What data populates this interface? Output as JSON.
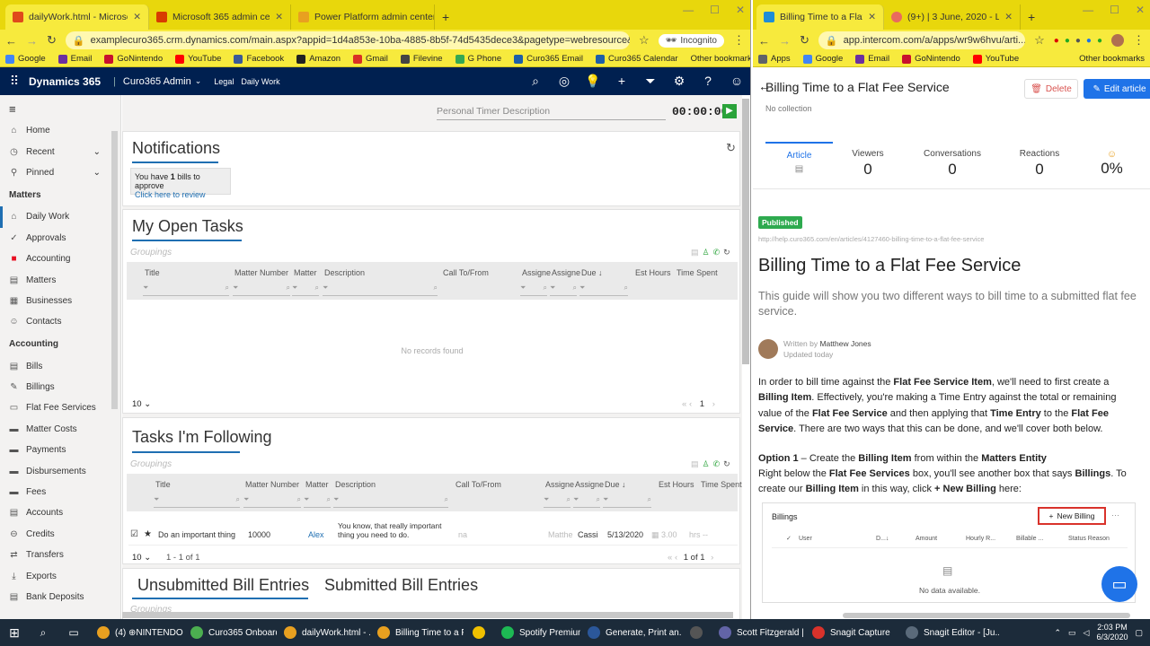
{
  "left_browser": {
    "tabs": [
      {
        "label": "dailyWork.html - Microsoft Dyna",
        "color": "#e04a1b"
      },
      {
        "label": "Microsoft 365 admin center - All",
        "color": "#d83b01"
      },
      {
        "label": "Power Platform admin center",
        "color": "#e8a020"
      }
    ],
    "new_tab": "+",
    "url": "examplecuro365.crm.dynamics.com/main.aspx?appid=1d4a853e-10ba-4885-8b5f-74d5435dece3&pagetype=webresource&webresourceName=cur...",
    "incognito": "Incognito",
    "bookmarks": [
      {
        "label": "Google",
        "color": "#4285f4"
      },
      {
        "label": "Email",
        "color": "#6b2fa0"
      },
      {
        "label": "GoNintendo",
        "color": "#c8102e"
      },
      {
        "label": "YouTube",
        "color": "#ff0000"
      },
      {
        "label": "Facebook",
        "color": "#3b5998"
      },
      {
        "label": "Amazon",
        "color": "#222222"
      },
      {
        "label": "Gmail",
        "color": "#d93025"
      },
      {
        "label": "Filevine",
        "color": "#444444"
      },
      {
        "label": "G Phone",
        "color": "#34a853"
      },
      {
        "label": "Curo365 Email",
        "color": "#1e5fa8"
      },
      {
        "label": "Curo365 Calendar",
        "color": "#1e5fa8"
      }
    ],
    "other_bookmarks": "Other bookmarks"
  },
  "d365": {
    "app": "Dynamics 365",
    "area": "Curo365 Admin",
    "crumb1": "Legal",
    "crumb2": "Daily Work",
    "timer_placeholder": "Personal Timer Description",
    "timer": "00:00:00"
  },
  "sidebar": {
    "top": [
      {
        "label": "Home",
        "icon": "⌂"
      },
      {
        "label": "Recent",
        "icon": "◷"
      },
      {
        "label": "Pinned",
        "icon": "⚲"
      }
    ],
    "matters_head": "Matters",
    "matters": [
      {
        "label": "Daily Work",
        "icon": "⌂"
      },
      {
        "label": "Approvals",
        "icon": "✓"
      },
      {
        "label": "Accounting",
        "icon": "■"
      },
      {
        "label": "Matters",
        "icon": "▤"
      },
      {
        "label": "Businesses",
        "icon": "▦"
      },
      {
        "label": "Contacts",
        "icon": "☺"
      }
    ],
    "accounting_head": "Accounting",
    "accounting": [
      {
        "label": "Bills",
        "icon": "▤"
      },
      {
        "label": "Billings",
        "icon": "✎"
      },
      {
        "label": "Flat Fee Services",
        "icon": "▭"
      },
      {
        "label": "Matter Costs",
        "icon": "▬"
      },
      {
        "label": "Payments",
        "icon": "▬"
      },
      {
        "label": "Disbursements",
        "icon": "▬"
      },
      {
        "label": "Fees",
        "icon": "▬"
      },
      {
        "label": "Accounts",
        "icon": "▤"
      },
      {
        "label": "Credits",
        "icon": "⊖"
      },
      {
        "label": "Transfers",
        "icon": "⇄"
      },
      {
        "label": "Exports",
        "icon": "⤓"
      },
      {
        "label": "Bank Deposits",
        "icon": "▤"
      }
    ]
  },
  "notifications": {
    "title": "Notifications",
    "line1_a": "You have ",
    "line1_b": "1",
    "line1_c": " bills to approve",
    "link": "Click here to review"
  },
  "open_tasks": {
    "title": "My Open Tasks",
    "groupings": "Groupings",
    "columns": [
      "Title",
      "Matter Number",
      "Matter",
      "Description",
      "Call To/From",
      "Assigne",
      "Assigne",
      "Due ↓",
      "Est Hours",
      "Time Spent"
    ],
    "empty": "No records found",
    "page_size": "10",
    "page": "1"
  },
  "following": {
    "title": "Tasks I'm Following",
    "groupings": "Groupings",
    "columns": [
      "Title",
      "Matter Number",
      "Matter",
      "Description",
      "Call To/From",
      "Assigne",
      "Assigne",
      "Due ↓",
      "Est Hours",
      "Time Spent"
    ],
    "row": {
      "title": "Do an important thing",
      "number": "10000",
      "matter": "Alex",
      "desc": "You know, that really important thing you need to do.",
      "call": "na",
      "a1": "Matthe",
      "a2": "Cassi",
      "due": "5/13/2020",
      "est": "3.00",
      "hrs": "hrs --"
    },
    "page_size": "10",
    "range": "1 - 1 of 1",
    "page": "1 of 1"
  },
  "bill_tabs": {
    "unsubmitted": "Unsubmitted Bill Entries",
    "submitted": "Submitted Bill Entries",
    "groupings": "Groupings"
  },
  "right_browser": {
    "tabs": [
      {
        "label": "Billing Time to a Flat Fee Ser",
        "color": "#1f8dd6"
      },
      {
        "label": "(9+) | 3 June, 2020 - Loom P",
        "color": "#e96a5e"
      }
    ],
    "url": "app.intercom.com/a/apps/wr9w6hvu/arti...",
    "bookmarks": [
      {
        "label": "Apps",
        "color": "#5f6368"
      },
      {
        "label": "Google",
        "color": "#4285f4"
      },
      {
        "label": "Email",
        "color": "#6b2fa0"
      },
      {
        "label": "GoNintendo",
        "color": "#c8102e"
      },
      {
        "label": "YouTube",
        "color": "#ff0000"
      }
    ],
    "other_bookmarks": "Other bookmarks"
  },
  "article": {
    "header_title": "Billing Time to a Flat Fee Service",
    "collection": "No collection",
    "delete": "Delete",
    "edit": "Edit article",
    "stats": [
      {
        "label": "Article",
        "value": ""
      },
      {
        "label": "Viewers",
        "value": "0"
      },
      {
        "label": "Conversations",
        "value": "0"
      },
      {
        "label": "Reactions",
        "value": "0"
      },
      {
        "label": "",
        "value": "0%"
      }
    ],
    "status": "Published",
    "link": "http://help.curo365.com/en/articles/4127460-billing-time-to-a-flat-fee-service",
    "title": "Billing Time to a Flat Fee Service",
    "lead": "This guide will show you two different ways to bill time to a submitted flat fee service.",
    "author_prefix": "Written by ",
    "author": "Matthew Jones",
    "updated": "Updated today",
    "p1": [
      {
        "t": "In order to bill time against the ",
        "b": false
      },
      {
        "t": "Flat Fee Service Item",
        "b": true
      },
      {
        "t": ", we'll need to first create a ",
        "b": false
      },
      {
        "t": "Billing Item",
        "b": true
      },
      {
        "t": ". Effectively, you're making a Time Entry against the total or remaining value of the ",
        "b": false
      },
      {
        "t": "Flat Fee Service",
        "b": true
      },
      {
        "t": " and then applying that ",
        "b": false
      },
      {
        "t": "Time Entry",
        "b": true
      },
      {
        "t": " to the ",
        "b": false
      },
      {
        "t": "Flat Fee Service",
        "b": true
      },
      {
        "t": ". There are two ways that this can be done, and we'll cover both below.",
        "b": false
      }
    ],
    "opt_a": "Option 1",
    "opt_b": " – Create the ",
    "opt_c": "Billing Item",
    "opt_d": " from within the ",
    "opt_e": "Matters Entity",
    "p2": [
      {
        "t": "Right below the ",
        "b": false
      },
      {
        "t": "Flat Fee Services",
        "b": true
      },
      {
        "t": " box, you'll see another box that says ",
        "b": false
      },
      {
        "t": "Billings",
        "b": true
      },
      {
        "t": ". To create our ",
        "b": false
      },
      {
        "t": "Billing Item",
        "b": true
      },
      {
        "t": " in this way, click ",
        "b": false
      },
      {
        "t": "+ New Billing",
        "b": true
      },
      {
        "t": " here:",
        "b": false
      }
    ],
    "shot": {
      "title": "Billings",
      "new": "New Billing",
      "more": "···",
      "cols": [
        "User",
        "D...↓",
        "Amount",
        "Hourly R...",
        "Billable ...",
        "Status Reason"
      ],
      "empty": "No data available."
    }
  },
  "taskbar": [
    {
      "label": "(4) ⊕NINTENDO R...",
      "color": "#e8a020"
    },
    {
      "label": "Curo365 Onboardi...",
      "color": "#4caf50"
    },
    {
      "label": "dailyWork.html - ...",
      "color": "#e8a020"
    },
    {
      "label": "Billing Time to a Fl...",
      "color": "#e8a020"
    },
    {
      "label": "",
      "color": "#f0c000"
    },
    {
      "label": "Spotify Premium",
      "color": "#1db954"
    },
    {
      "label": "Generate, Print an...",
      "color": "#2b579a"
    },
    {
      "label": "",
      "color": "#555555"
    },
    {
      "label": "Scott Fitzgerald | ...",
      "color": "#6264a7"
    },
    {
      "label": "Snagit Capture",
      "color": "#d9322b"
    },
    {
      "label": "Snagit Editor - [Ju...",
      "color": "#5a6a7a"
    }
  ],
  "clock": {
    "time": "2:03 PM",
    "date": "6/3/2020"
  },
  "colors": {
    "chrome_yellow": "#f7ea3d",
    "d365_nav": "#002050",
    "accent_blue": "#1f6fb2",
    "intercom_blue": "#1f73e8",
    "published_green": "#2eaa4f",
    "delete_red": "#d9534f"
  }
}
